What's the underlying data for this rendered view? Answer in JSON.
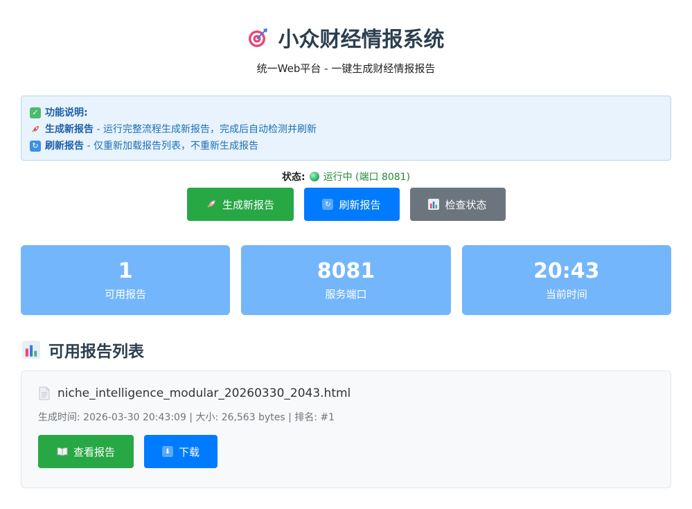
{
  "header": {
    "title": "小众财经情报系统",
    "subtitle": "统一Web平台 - 一键生成财经情报报告"
  },
  "info": {
    "heading": "功能说明:",
    "line1_bold": "生成新报告",
    "line1_text": " - 运行完整流程生成新报告，完成后自动检测并刷新",
    "line2_bold": "刷新报告",
    "line2_text": " - 仅重新加载报告列表，不重新生成报告"
  },
  "status": {
    "label": "状态:",
    "text": "运行中 (端口 8081)"
  },
  "actions": {
    "generate": "生成新报告",
    "refresh": "刷新报告",
    "check": "检查状态"
  },
  "stats": [
    {
      "value": "1",
      "label": "可用报告"
    },
    {
      "value": "8081",
      "label": "服务端口"
    },
    {
      "value": "20:43",
      "label": "当前时间"
    }
  ],
  "reports_section": {
    "title": "可用报告列表"
  },
  "reports": [
    {
      "filename": "niche_intelligence_modular_20260330_2043.html",
      "meta": "生成时间: 2026-03-30 20:43:09 | 大小: 26,563 bytes | 排名: #1",
      "view_label": "查看报告",
      "download_label": "下载"
    }
  ],
  "colors": {
    "green": "#28a745",
    "blue": "#007bff",
    "gray": "#6c757d",
    "stat_bg": "#74b6fb",
    "info_bg": "#e8f3fd"
  },
  "icons": {
    "title": "target-icon",
    "info_heading": "check-icon",
    "generate": "rocket-icon",
    "refresh": "refresh-icon",
    "check": "bar-chart-icon",
    "section": "bar-chart-icon",
    "file": "document-icon",
    "view": "book-icon",
    "download": "down-arrow-icon"
  }
}
